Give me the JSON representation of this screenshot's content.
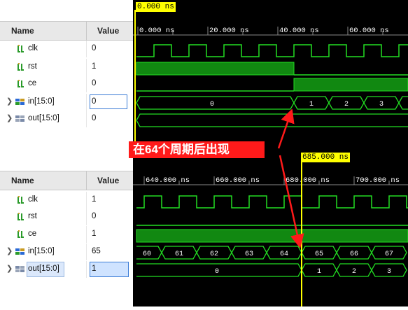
{
  "panels": [
    {
      "header": {
        "name_label": "Name",
        "value_label": "Value"
      },
      "cursor_label": "0.000 ns",
      "time_ticks": [
        "0.000 ns",
        "20.000 ns",
        "40.000 ns",
        "60.000 ns"
      ],
      "signals": [
        {
          "name": "clk",
          "value": "0"
        },
        {
          "name": "rst",
          "value": "1"
        },
        {
          "name": "ce",
          "value": "0"
        },
        {
          "name": "in[15:0]",
          "value": "0"
        },
        {
          "name": "out[15:0]",
          "value": "0"
        }
      ],
      "in_bus_values": [
        "0",
        "1",
        "2",
        "3"
      ],
      "out_bus_values": []
    },
    {
      "header": {
        "name_label": "Name",
        "value_label": "Value"
      },
      "cursor_label": "685.000 ns",
      "time_ticks": [
        "640.000 ns",
        "660.000 ns",
        "680.000 ns",
        "700.000 ns"
      ],
      "signals": [
        {
          "name": "clk",
          "value": "1"
        },
        {
          "name": "rst",
          "value": "0"
        },
        {
          "name": "ce",
          "value": "1"
        },
        {
          "name": "in[15:0]",
          "value": "65"
        },
        {
          "name": "out[15:0]",
          "value": "1"
        }
      ],
      "in_bus_values": [
        "60",
        "61",
        "62",
        "63",
        "64",
        "65",
        "66",
        "67"
      ],
      "out_bus_values": [
        "0",
        "1",
        "2",
        "3"
      ]
    }
  ],
  "annotation": {
    "text": "在64个周期后出现"
  },
  "colors": {
    "wave": "#22dd22",
    "cursor": "#ffff00",
    "annotation": "#ff1a1a",
    "background": "#000000"
  }
}
